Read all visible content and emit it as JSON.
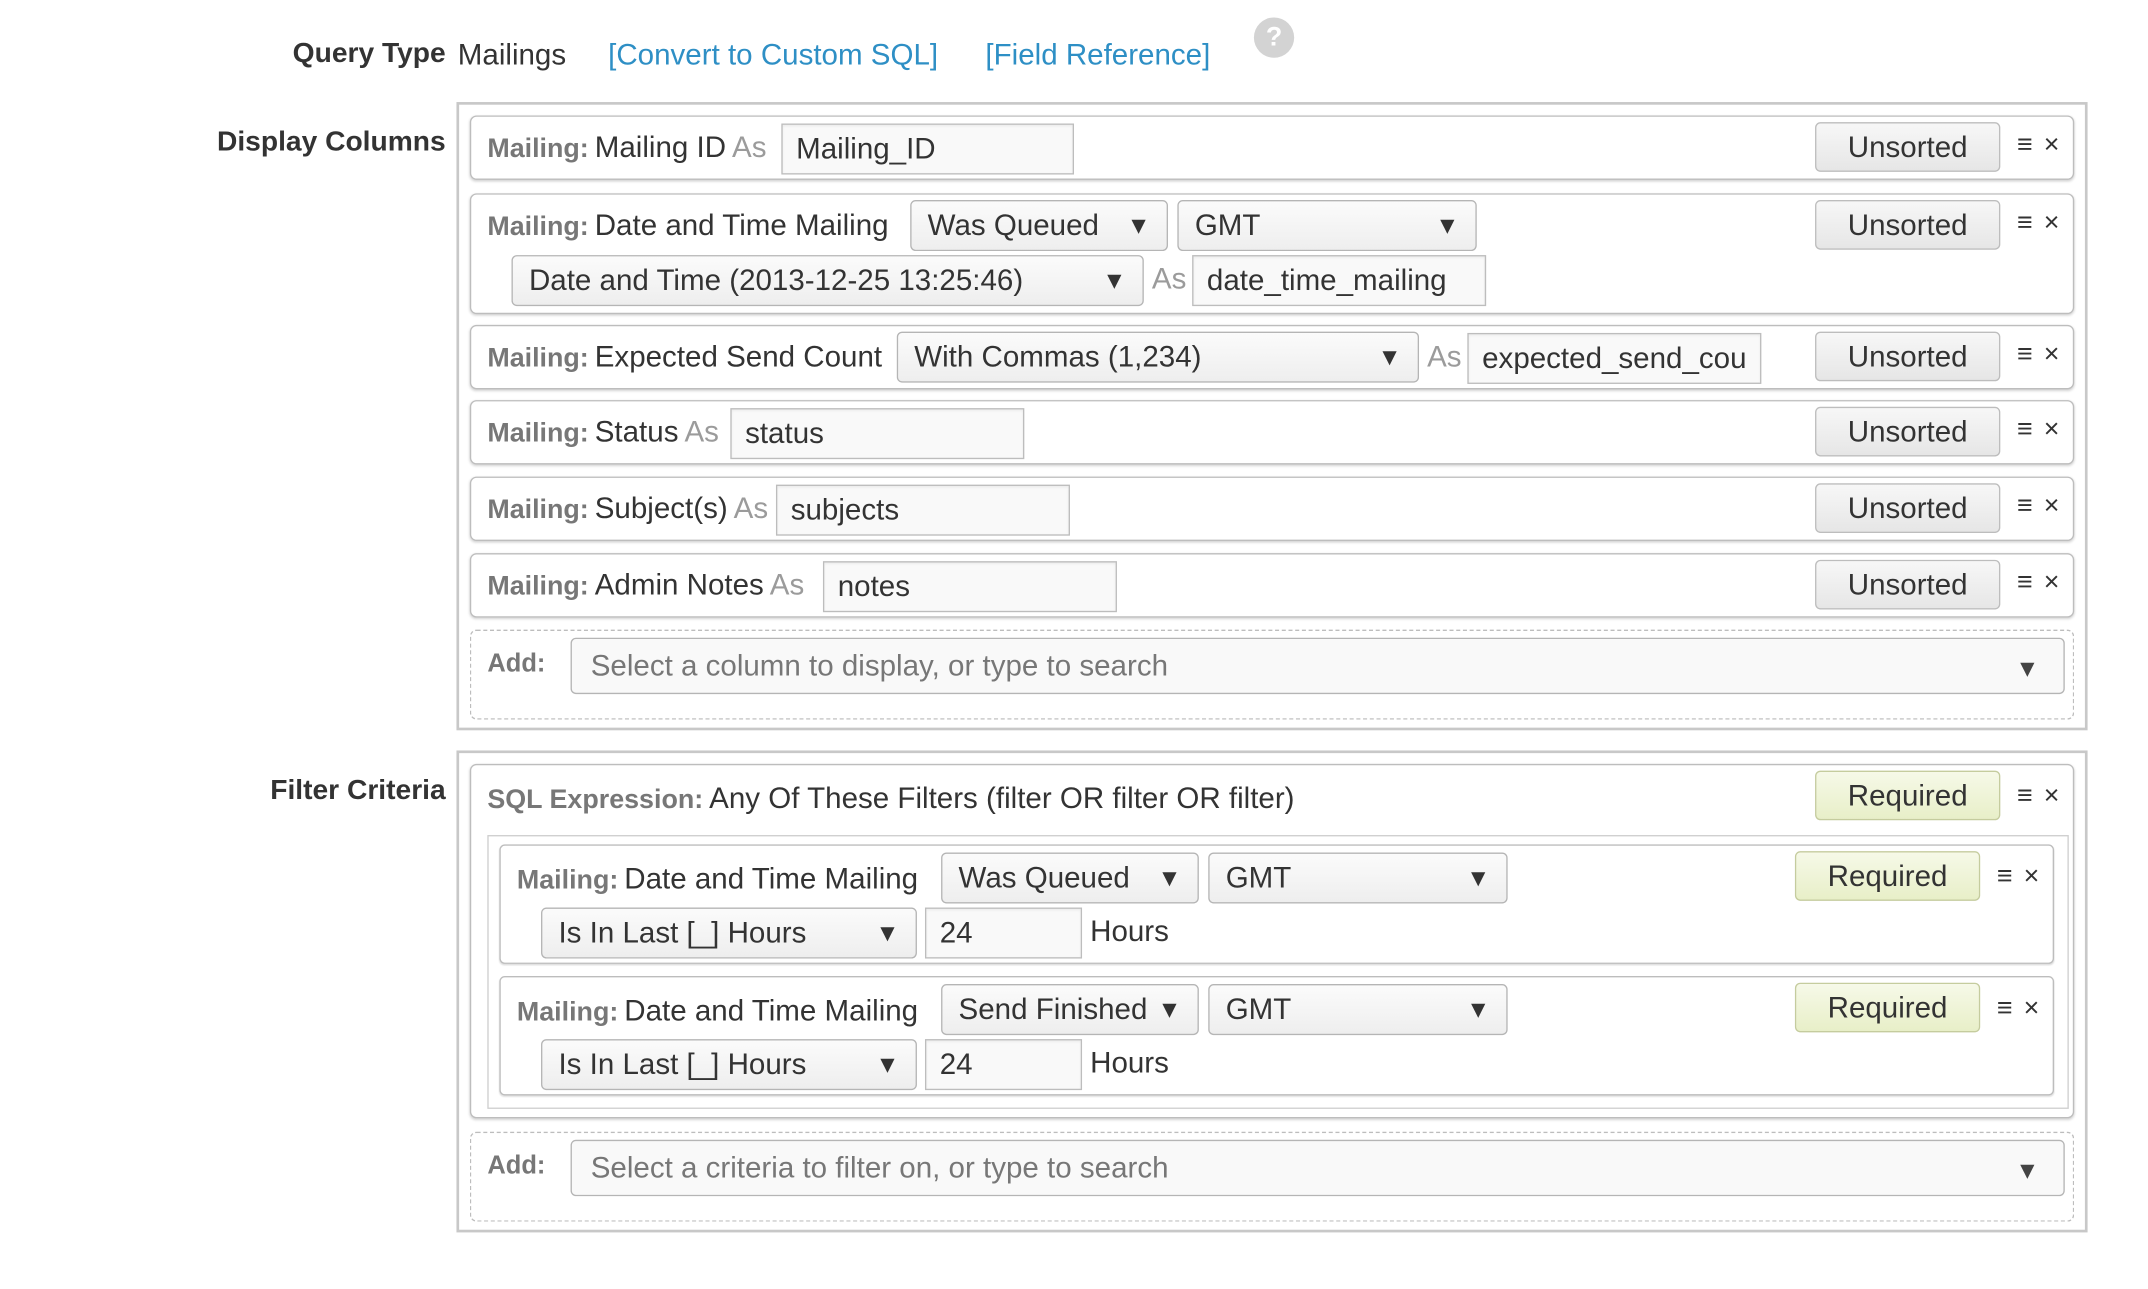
{
  "query_type": {
    "label": "Query Type",
    "value": "Mailings",
    "convert_link": "[Convert to Custom SQL]",
    "field_ref_link": "[Field Reference]",
    "help": "?"
  },
  "display_columns": {
    "label": "Display Columns",
    "rows": [
      {
        "prefix": "Mailing:",
        "field": "Mailing ID",
        "as": "As",
        "alias": "Mailing_ID",
        "sort": "Unsorted"
      },
      {
        "prefix": "Mailing:",
        "field": "Date and Time Mailing",
        "sel1": "Was Queued",
        "sel2": "GMT",
        "sel3": "Date and Time (2013-12-25 13:25:46)",
        "as": "As",
        "alias": "date_time_mailing",
        "sort": "Unsorted"
      },
      {
        "prefix": "Mailing:",
        "field": "Expected Send Count",
        "sel1": "With Commas (1,234)",
        "as": "As",
        "alias": "expected_send_cou",
        "sort": "Unsorted"
      },
      {
        "prefix": "Mailing:",
        "field": "Status",
        "as": "As",
        "alias": "status",
        "sort": "Unsorted"
      },
      {
        "prefix": "Mailing:",
        "field": "Subject(s)",
        "as": "As",
        "alias": "subjects",
        "sort": "Unsorted"
      },
      {
        "prefix": "Mailing:",
        "field": "Admin Notes",
        "as": "As",
        "alias": "notes",
        "sort": "Unsorted"
      }
    ],
    "add_label": "Add:",
    "add_placeholder": "Select a column to display, or type to search"
  },
  "filter_criteria": {
    "label": "Filter Criteria",
    "sql": {
      "prefix": "SQL Expression:",
      "text": "Any Of These Filters (filter OR filter OR filter)",
      "req": "Required"
    },
    "subs": [
      {
        "prefix": "Mailing:",
        "field": "Date and Time Mailing",
        "sel1": "Was Queued",
        "sel2": "GMT",
        "cond": "Is In Last [_] Hours",
        "value": "24",
        "unit": "Hours",
        "req": "Required"
      },
      {
        "prefix": "Mailing:",
        "field": "Date and Time Mailing",
        "sel1": "Send Finished",
        "sel2": "GMT",
        "cond": "Is In Last [_] Hours",
        "value": "24",
        "unit": "Hours",
        "req": "Required"
      }
    ],
    "add_label": "Add:",
    "add_placeholder": "Select a criteria to filter on, or type to search"
  },
  "icons": {
    "drag": "≡",
    "remove": "×",
    "arrow": "▼"
  }
}
